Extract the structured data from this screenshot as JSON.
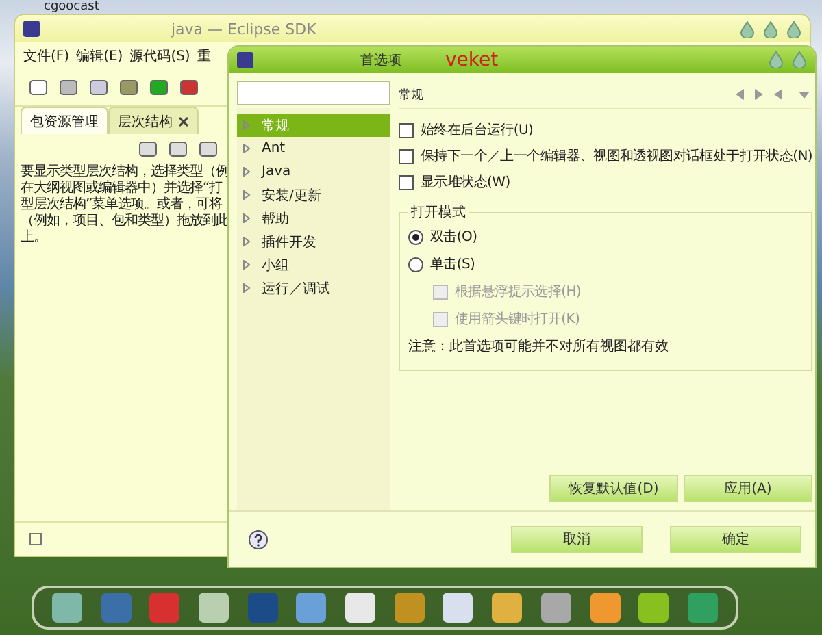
{
  "desktop": {
    "label": "cgoocast"
  },
  "eclipse": {
    "title": "java — Eclipse SDK",
    "menu": [
      "文件(F)",
      "编辑(E)",
      "源代码(S)",
      "重"
    ],
    "tabs": [
      {
        "label": "包资源管理",
        "selected": true,
        "closable": false
      },
      {
        "label": "层次结构",
        "selected": false,
        "closable": true
      }
    ],
    "hint_lines": [
      "要显示类型层次结构，选择类型（例",
      "在大纲视图或编辑器中）并选择“打",
      "型层次结构”菜单选项。或者，可将",
      "（例如，项目、包和类型）拖放到此",
      "上。"
    ]
  },
  "dialog": {
    "title": "首选项",
    "badge": "veket",
    "tree": [
      {
        "label": "常规",
        "selected": true,
        "expanded": false
      },
      {
        "label": "Ant",
        "selected": false,
        "expanded": false
      },
      {
        "label": "Java",
        "selected": false,
        "expanded": false
      },
      {
        "label": "安装/更新",
        "selected": false,
        "expanded": false
      },
      {
        "label": "帮助",
        "selected": false,
        "expanded": false
      },
      {
        "label": "插件开发",
        "selected": false,
        "expanded": false
      },
      {
        "label": "小组",
        "selected": false,
        "expanded": false
      },
      {
        "label": "运行／调试",
        "selected": false,
        "expanded": false
      }
    ],
    "page_title": "常规",
    "options": [
      {
        "label": "始终在后台运行(U)",
        "checked": false
      },
      {
        "label": "保持下一个／上一个编辑器、视图和透视图对话框处于打开状态(N)",
        "checked": false
      },
      {
        "label": "显示堆状态(W)",
        "checked": false
      }
    ],
    "group": {
      "title": "打开模式",
      "items": [
        {
          "kind": "radio",
          "label": "双击(O)",
          "selected": true,
          "disabled": false
        },
        {
          "kind": "radio",
          "label": "单击(S)",
          "selected": false,
          "disabled": false
        },
        {
          "kind": "checkbox",
          "label": "根据悬浮提示选择(H)",
          "checked": false,
          "disabled": true
        },
        {
          "kind": "checkbox",
          "label": "使用箭头键时打开(K)",
          "checked": false,
          "disabled": true
        }
      ]
    },
    "note": "注意：此首选项可能并不对所有视图都有效",
    "page_buttons": [
      "恢复默认值(D)",
      "应用(A)"
    ],
    "buttons": [
      "取消",
      "确定"
    ]
  }
}
